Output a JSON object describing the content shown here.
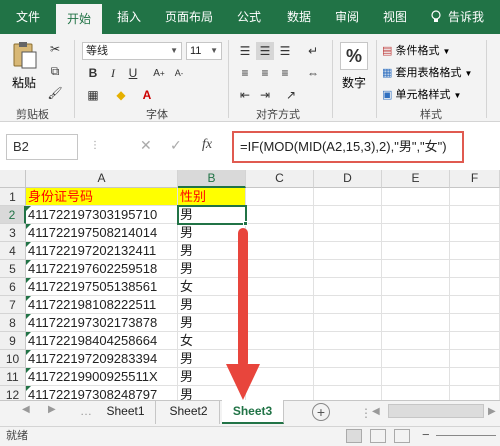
{
  "tabs": [
    "文件",
    "开始",
    "插入",
    "页面布局",
    "公式",
    "数据",
    "审阅",
    "视图",
    "告诉我"
  ],
  "ribbon": {
    "paste_label": "粘贴",
    "font_name": "等线",
    "font_size": "11",
    "percent_label": "数字",
    "cond_format": "条件格式",
    "table_format": "套用表格格式",
    "cell_style": "单元格样式",
    "groups": {
      "clipboard": "剪贴板",
      "font": "字体",
      "align": "对齐方式",
      "style": "样式"
    }
  },
  "formula_bar": {
    "name_box": "B2",
    "fx": "fx",
    "formula": "=IF(MOD(MID(A2,15,3),2),\"男\",\"女\")"
  },
  "columns": [
    "A",
    "B",
    "C",
    "D",
    "E",
    "F"
  ],
  "rows": [
    {
      "n": "1",
      "a": "身份证号码",
      "b": "性别"
    },
    {
      "n": "2",
      "a": "411722197303195710",
      "b": "男"
    },
    {
      "n": "3",
      "a": "411722197508214014",
      "b": "男"
    },
    {
      "n": "4",
      "a": "411722197202132411",
      "b": "男"
    },
    {
      "n": "5",
      "a": "411722197602259518",
      "b": "男"
    },
    {
      "n": "6",
      "a": "411722197505138561",
      "b": "女"
    },
    {
      "n": "7",
      "a": "411722198108222511",
      "b": "男"
    },
    {
      "n": "8",
      "a": "411722197302173878",
      "b": "男"
    },
    {
      "n": "9",
      "a": "411722198404258664",
      "b": "女"
    },
    {
      "n": "10",
      "a": "411722197209283394",
      "b": "男"
    },
    {
      "n": "11",
      "a": "41172219900925511X",
      "b": "男"
    },
    {
      "n": "12",
      "a": "411722197308248797",
      "b": "男"
    }
  ],
  "sheets": [
    "Sheet1",
    "Sheet2",
    "Sheet3"
  ],
  "status": "就绪",
  "colors": {
    "accent": "#217346",
    "header_fill": "#ffff00",
    "header_text": "#ff0000",
    "arrow": "#e8453c"
  }
}
